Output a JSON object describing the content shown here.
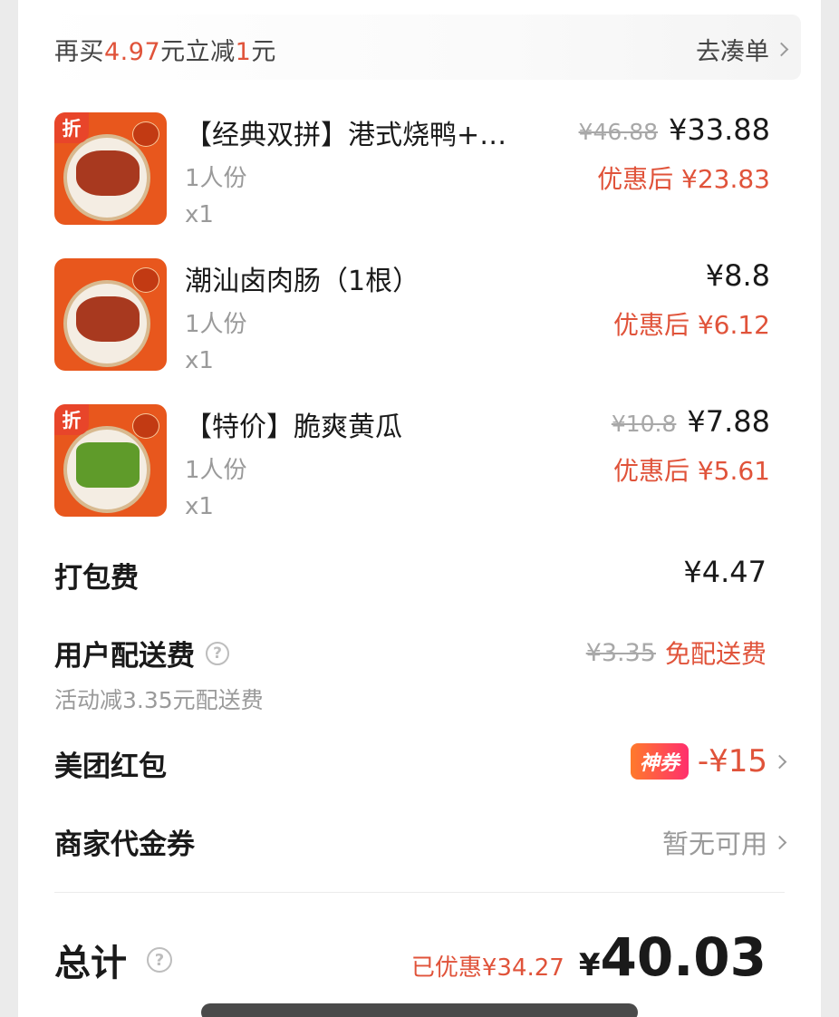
{
  "promo": {
    "prefix": "再买",
    "amount": "4.97",
    "middle": "元立减",
    "discount": "1",
    "suffix": "元",
    "link_label": "去凑单"
  },
  "items": [
    {
      "name": "【经典双拼】港式烧鸭+…",
      "spec": "1人份",
      "qty": "x1",
      "original_price": "¥46.88",
      "price": "¥33.88",
      "discounted": "优惠后 ¥23.83",
      "discount_tag": "折"
    },
    {
      "name": "潮汕卤肉肠（1根）",
      "spec": "1人份",
      "qty": "x1",
      "original_price": "",
      "price": "¥8.8",
      "discounted": "优惠后 ¥6.12",
      "discount_tag": ""
    },
    {
      "name": "【特价】脆爽黄瓜",
      "spec": "1人份",
      "qty": "x1",
      "original_price": "¥10.8",
      "price": "¥7.88",
      "discounted": "优惠后 ¥5.61",
      "discount_tag": "折"
    }
  ],
  "packing": {
    "label": "打包费",
    "value": "¥4.47"
  },
  "delivery": {
    "label": "用户配送费",
    "help": "?",
    "sub": "活动减3.35元配送费",
    "original": "¥3.35",
    "value": "免配送费"
  },
  "red_packet": {
    "label": "美团红包",
    "badge": "神券",
    "value": "-¥15"
  },
  "merchant_coupon": {
    "label": "商家代金券",
    "value": "暂无可用"
  },
  "total": {
    "label": "总计",
    "help": "?",
    "saved": "已优惠¥34.27",
    "currency": "¥",
    "value": "40.03"
  },
  "colors": {
    "accent": "#e0533a",
    "text": "#1a1a1a",
    "muted": "#9a9a9a"
  }
}
